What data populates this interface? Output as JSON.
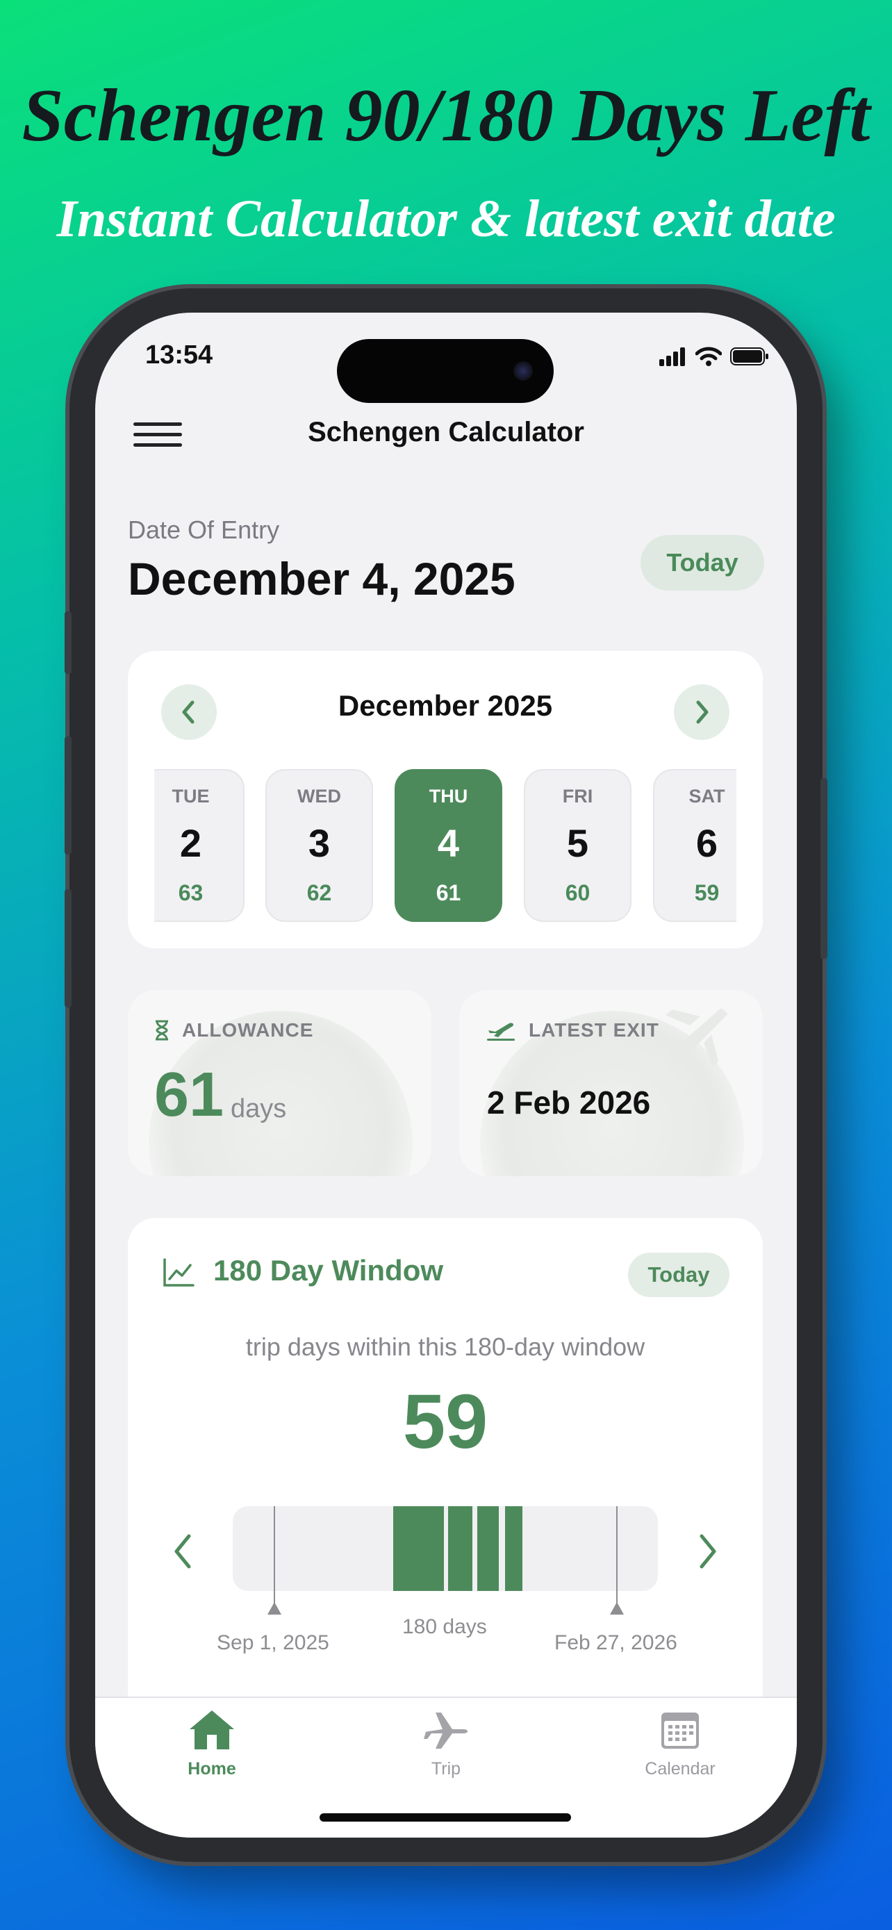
{
  "promo": {
    "headline": "Schengen 90/180 Days Left",
    "subheadline": "Instant Calculator & latest exit date"
  },
  "status_bar": {
    "time": "13:54"
  },
  "nav": {
    "title": "Schengen Calculator",
    "menu_icon": "hamburger-menu-icon"
  },
  "entry": {
    "label": "Date Of Entry",
    "date": "December 4, 2025",
    "today_button": "Today"
  },
  "calendar": {
    "month": "December 2025",
    "days": [
      {
        "dow": "TUE",
        "num": "2",
        "remaining": "63"
      },
      {
        "dow": "WED",
        "num": "3",
        "remaining": "62"
      },
      {
        "dow": "THU",
        "num": "4",
        "remaining": "61",
        "selected": true
      },
      {
        "dow": "FRI",
        "num": "5",
        "remaining": "60"
      },
      {
        "dow": "SAT",
        "num": "6",
        "remaining": "59"
      }
    ]
  },
  "allowance": {
    "label": "ALLOWANCE",
    "value": "61",
    "unit": "days"
  },
  "latest_exit": {
    "label": "LATEST EXIT",
    "date": "2 Feb 2026"
  },
  "window": {
    "title": "180 Day Window",
    "today_button": "Today",
    "caption": "trip days within this 180-day window",
    "count": "59",
    "start_label": "Sep 1, 2025",
    "center_label": "180 days",
    "end_label": "Feb 27, 2026"
  },
  "tabs": [
    {
      "label": "Home",
      "icon": "home-icon",
      "active": true
    },
    {
      "label": "Trip",
      "icon": "airplane-icon"
    },
    {
      "label": "Calendar",
      "icon": "calendar-icon"
    }
  ],
  "colors": {
    "accent": "#4d8a5b",
    "accent_soft": "#dfe9e1",
    "background": "#f2f2f5"
  }
}
